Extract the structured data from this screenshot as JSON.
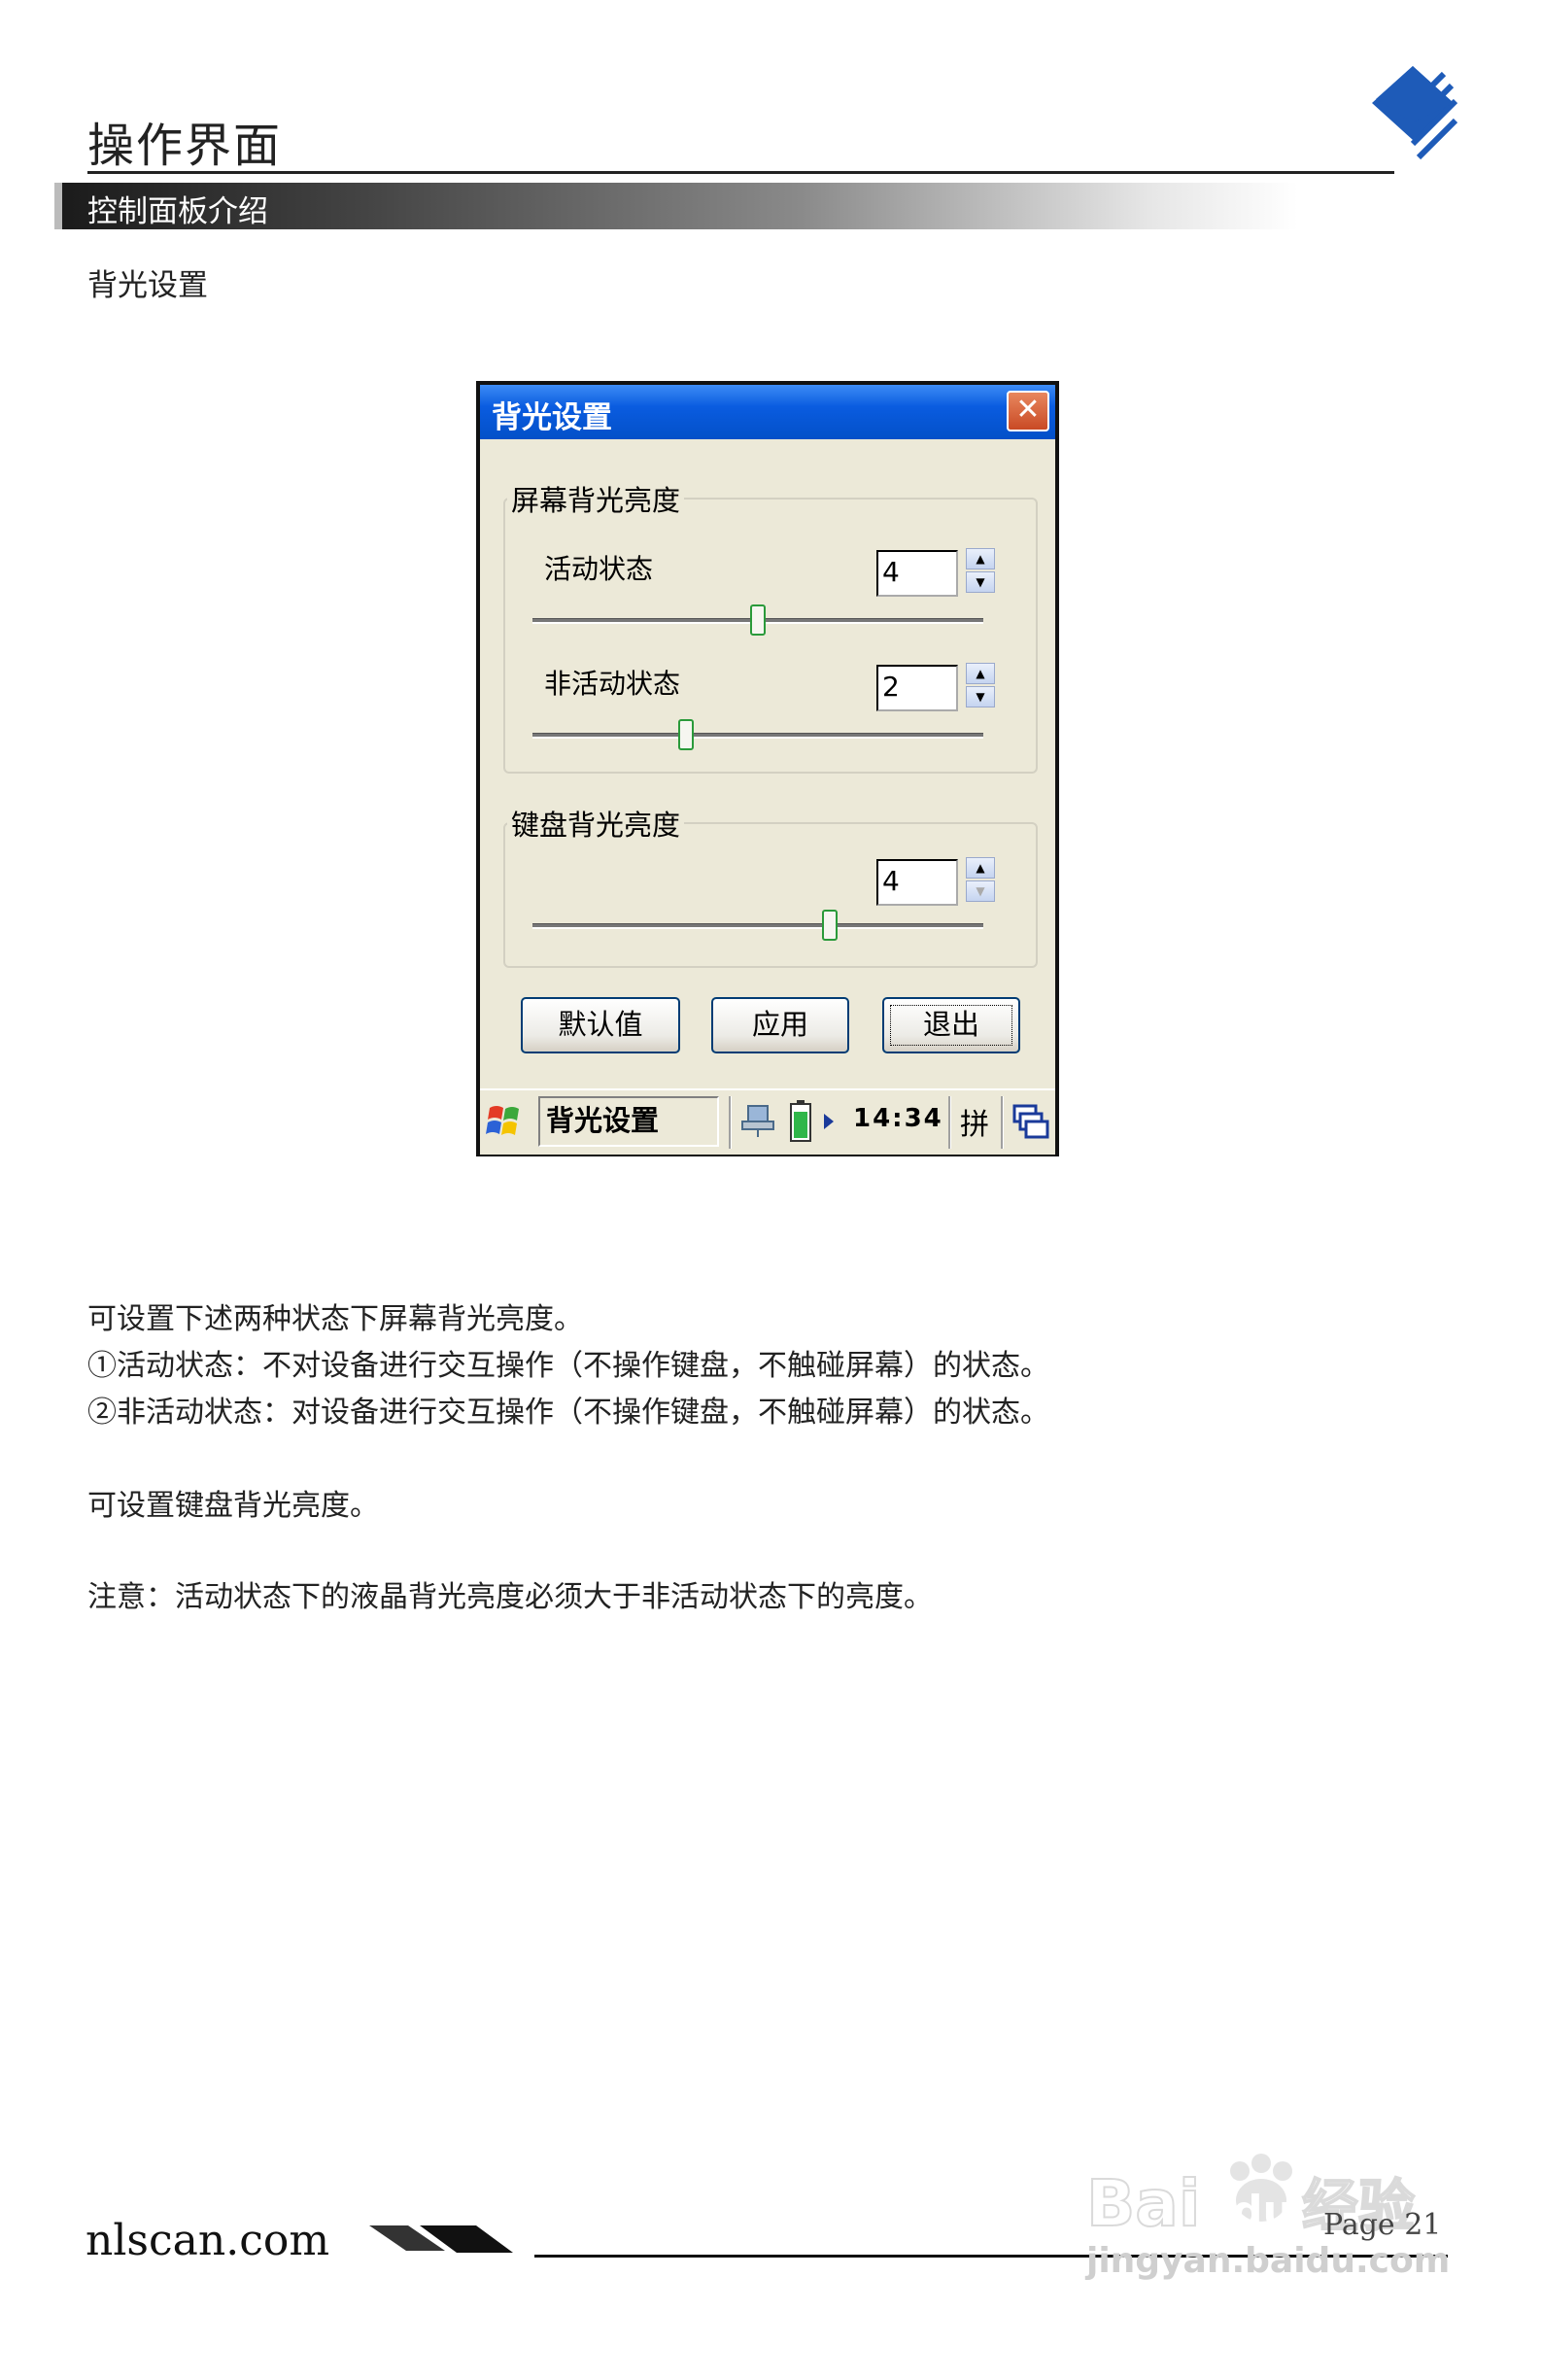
{
  "header": {
    "title": "操作界面",
    "section": "控制面板介绍"
  },
  "subheading": "背光设置",
  "dialog": {
    "title": "背光设置",
    "close_icon": "close-icon",
    "screen_group": {
      "label": "屏幕背光亮度",
      "active": {
        "label": "活动状态",
        "value": "4",
        "slider_fraction": 0.5
      },
      "inactive": {
        "label": "非活动状态",
        "value": "2",
        "slider_fraction": 0.34
      }
    },
    "keyboard_group": {
      "label": "键盘背光亮度",
      "value": "4",
      "slider_fraction": 0.66
    },
    "buttons": {
      "default": "默认值",
      "apply": "应用",
      "exit": "退出"
    },
    "taskbar": {
      "start_icon": "windows-start-icon",
      "task_label": "背光设置",
      "network_icon": "network-icon",
      "battery_icon": "battery-icon",
      "clock": "14:34",
      "ime": "拼",
      "window_switch_icon": "window-switch-icon"
    }
  },
  "body": {
    "p1": "可设置下述两种状态下屏幕背光亮度。",
    "p2": "①活动状态：不对设备进行交互操作（不操作键盘，不触碰屏幕）的状态。",
    "p3": "②非活动状态：对设备进行交互操作（不操作键盘，不触碰屏幕）的状态。",
    "p4": "可设置键盘背光亮度。",
    "p5": "注意：活动状态下的液晶背光亮度必须大于非活动状态下的亮度。"
  },
  "footer": {
    "url": "nlscan.com",
    "page": "Page  21"
  },
  "watermark": {
    "logo_text": "Bai du 经验",
    "url": "jingyan.baidu.com"
  }
}
